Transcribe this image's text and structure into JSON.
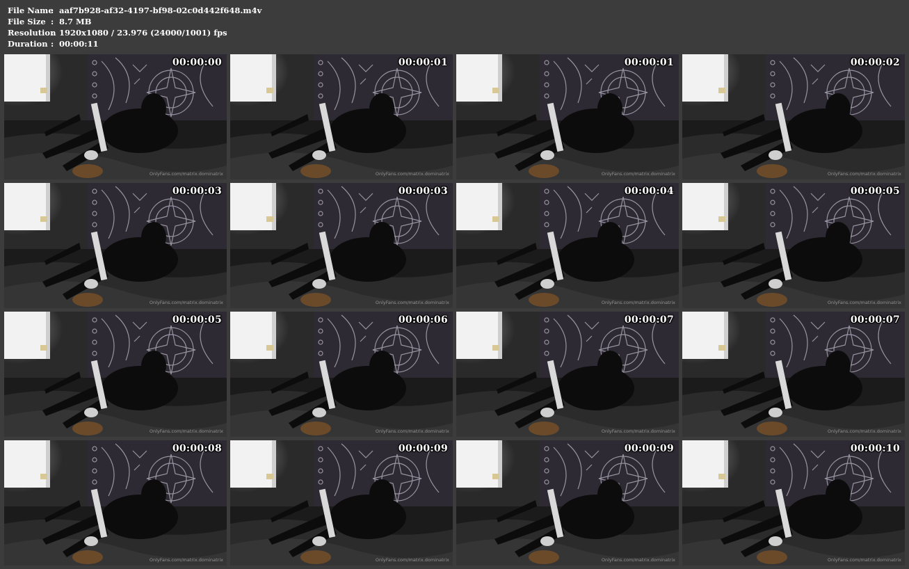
{
  "info": {
    "filename_label": "File Name",
    "filename_value": "aaf7b928-af32-4197-bf98-02c0d442f648.m4v",
    "filesize_label": "File Size",
    "filesize_value": "8.7 MB",
    "resolution_label": "Resolution",
    "resolution_value": "1920x1080 / 23.976 (24000/1001) fps",
    "duration_label": "Duration",
    "duration_value": "00:00:11",
    "separator": ":"
  },
  "watermark": "OnlyFans.com/matrix.dominatrix",
  "thumbnails": [
    {
      "timestamp": "00:00:00"
    },
    {
      "timestamp": "00:00:01"
    },
    {
      "timestamp": "00:00:01"
    },
    {
      "timestamp": "00:00:02"
    },
    {
      "timestamp": "00:00:03"
    },
    {
      "timestamp": "00:00:03"
    },
    {
      "timestamp": "00:00:04"
    },
    {
      "timestamp": "00:00:05"
    },
    {
      "timestamp": "00:00:05"
    },
    {
      "timestamp": "00:00:06"
    },
    {
      "timestamp": "00:00:07"
    },
    {
      "timestamp": "00:00:07"
    },
    {
      "timestamp": "00:00:08"
    },
    {
      "timestamp": "00:00:09"
    },
    {
      "timestamp": "00:00:09"
    },
    {
      "timestamp": "00:00:10"
    }
  ]
}
